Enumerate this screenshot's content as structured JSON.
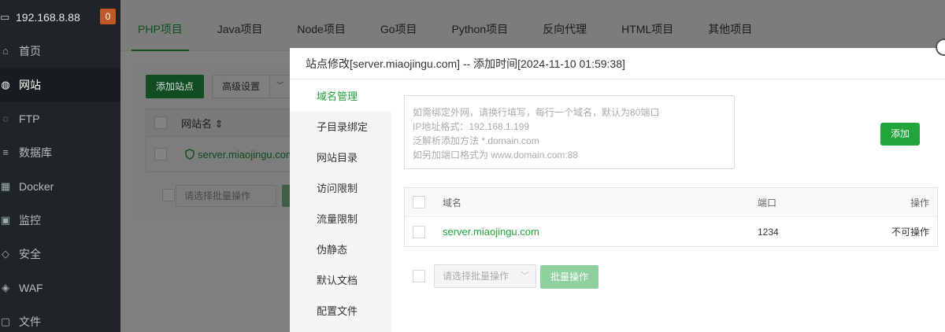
{
  "sidebar": {
    "ip": "192.168.8.88",
    "badge": "0",
    "items": [
      {
        "label": "首页",
        "icon": "home-icon"
      },
      {
        "label": "网站",
        "icon": "globe-icon"
      },
      {
        "label": "FTP",
        "icon": "ftp-icon"
      },
      {
        "label": "数据库",
        "icon": "database-icon"
      },
      {
        "label": "Docker",
        "icon": "docker-icon"
      },
      {
        "label": "监控",
        "icon": "monitor-icon"
      },
      {
        "label": "安全",
        "icon": "shield-icon"
      },
      {
        "label": "WAF",
        "icon": "waf-icon"
      },
      {
        "label": "文件",
        "icon": "folder-icon"
      }
    ]
  },
  "tabs": [
    "PHP项目",
    "Java项目",
    "Node项目",
    "Go项目",
    "Python项目",
    "反向代理",
    "HTML项目",
    "其他项目"
  ],
  "background": {
    "add_site": "添加站点",
    "advanced": "高级设置",
    "col_site_name": "网站名",
    "site": "server.miaojingu.com",
    "batch_placeholder": "请选择批量操作"
  },
  "modal": {
    "title": "站点修改[server.miaojingu.com] -- 添加时间[2024-11-10 01:59:38]",
    "menu": [
      "域名管理",
      "子目录绑定",
      "网站目录",
      "访问限制",
      "流量限制",
      "伪静态",
      "默认文档",
      "配置文件"
    ],
    "textarea_placeholder": "如需绑定外网，请换行填写，每行一个域名，默认为80端口\nIP地址格式：192.168.1.199\n泛解析添加方法 *.domain.com\n如另加端口格式为 www.domain.com:88",
    "add_button": "添加",
    "table": {
      "headers": {
        "domain": "域名",
        "port": "端口",
        "op": "操作"
      },
      "rows": [
        {
          "domain": "server.miaojingu.com",
          "port": "1234",
          "op": "不可操作"
        }
      ]
    },
    "batch_placeholder": "请选择批量操作",
    "batch_button": "批量操作"
  },
  "colors": {
    "accent": "#20a53a",
    "sidebar_bg": "#1f2427"
  }
}
